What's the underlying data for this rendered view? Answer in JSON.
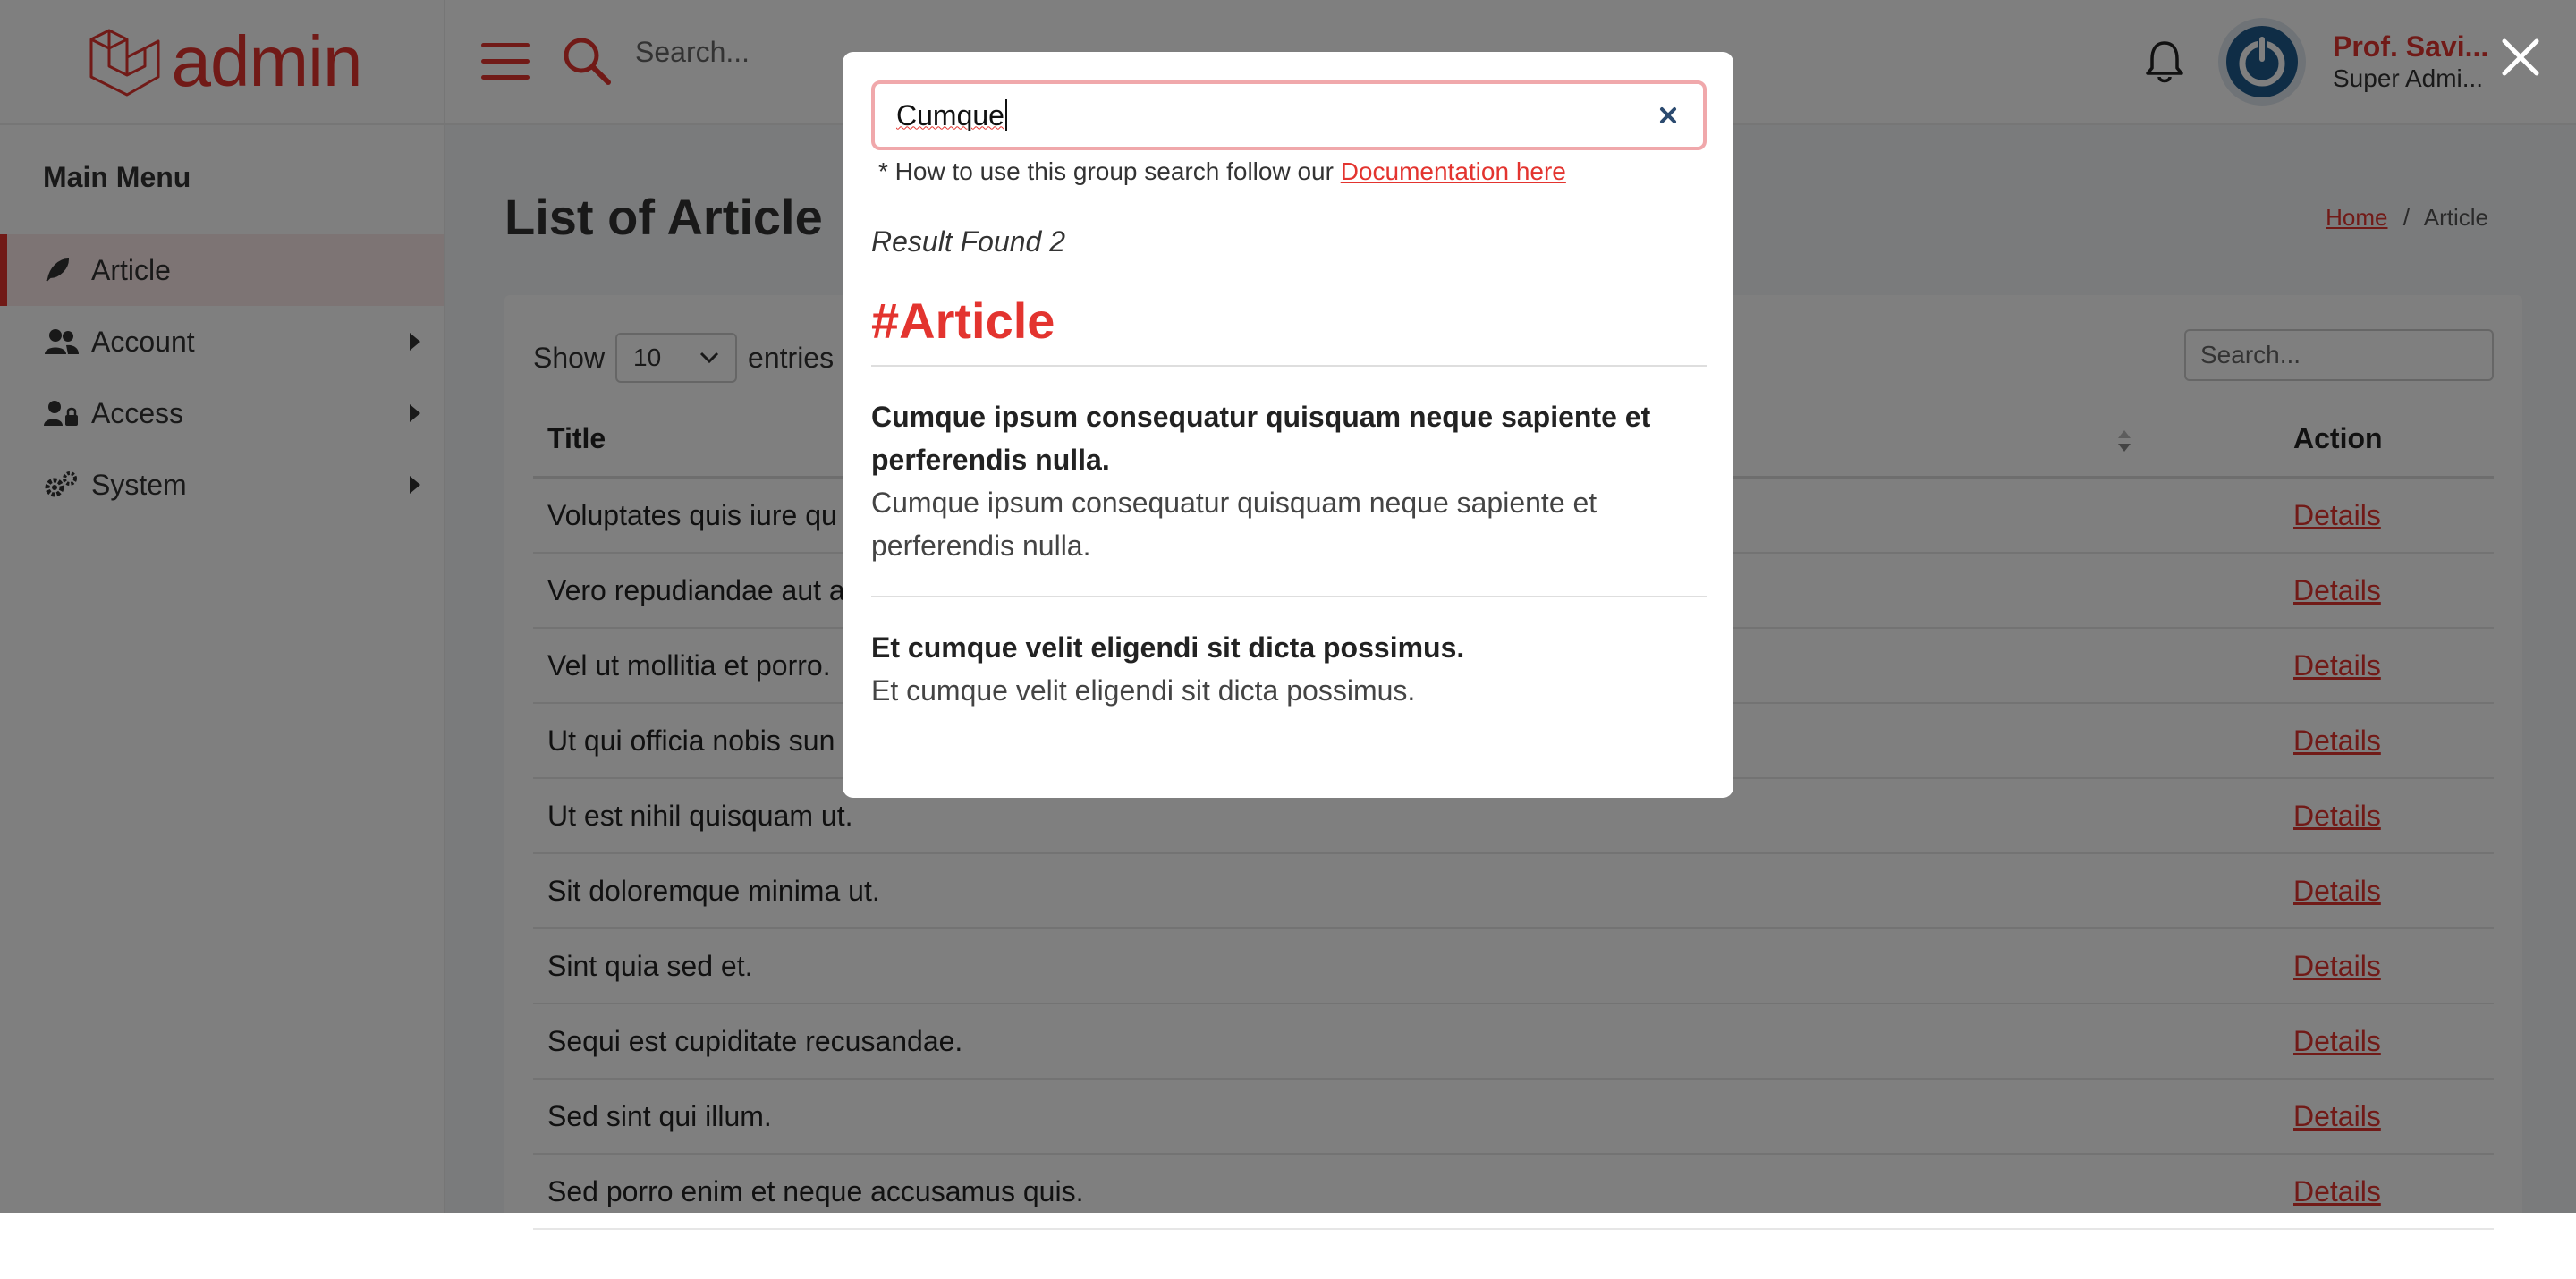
{
  "brand": {
    "name": "admin",
    "color": "#e3342f"
  },
  "sidebar": {
    "title": "Main Menu",
    "items": [
      {
        "label": "Article",
        "icon": "feather-icon",
        "active": true
      },
      {
        "label": "Account",
        "icon": "users-icon",
        "has_submenu": true
      },
      {
        "label": "Access",
        "icon": "user-lock-icon",
        "has_submenu": true
      },
      {
        "label": "System",
        "icon": "gears-icon",
        "has_submenu": true
      }
    ]
  },
  "topbar": {
    "search_placeholder": "Search...",
    "user_name": "Prof. Savi...",
    "user_role": "Super Admi..."
  },
  "page": {
    "title": "List of Article",
    "breadcrumb": {
      "home": "Home",
      "separator": "/",
      "current": "Article"
    }
  },
  "table": {
    "show_label": "Show",
    "entries_label": "entries",
    "page_size": "10",
    "search_placeholder": "Search...",
    "columns": [
      "Title",
      "Action"
    ],
    "rows": [
      {
        "title": "Voluptates quis iure qu",
        "action": "Details"
      },
      {
        "title": "Vero repudiandae aut a",
        "action": "Details"
      },
      {
        "title": "Vel ut mollitia et porro.",
        "action": "Details"
      },
      {
        "title": "Ut qui officia nobis sun",
        "action": "Details"
      },
      {
        "title": "Ut est nihil quisquam ut.",
        "action": "Details"
      },
      {
        "title": "Sit doloremque minima ut.",
        "action": "Details"
      },
      {
        "title": "Sint quia sed et.",
        "action": "Details"
      },
      {
        "title": "Sequi est cupiditate recusandae.",
        "action": "Details"
      },
      {
        "title": "Sed sint qui illum.",
        "action": "Details"
      },
      {
        "title": "Sed porro enim et neque accusamus quis.",
        "action": "Details"
      }
    ]
  },
  "modal": {
    "search_value": "Cumque",
    "help_text": "* How to use this group search follow our ",
    "help_link": "Documentation here",
    "result_found": "Result Found 2",
    "group_title": "#Article",
    "results": [
      {
        "title": "Cumque ipsum consequatur quisquam neque sapiente et perferendis nulla.",
        "body": "Cumque ipsum consequatur quisquam neque sapiente et perferendis nulla."
      },
      {
        "title": "Et cumque velit eligendi sit dicta possimus.",
        "body": "Et cumque velit eligendi sit dicta possimus."
      }
    ]
  }
}
